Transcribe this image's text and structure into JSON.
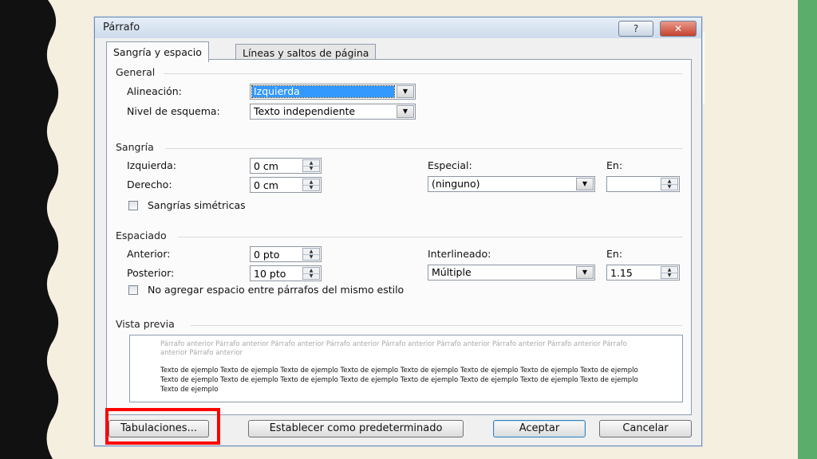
{
  "dialog": {
    "title": "Párrafo",
    "help_icon": "?",
    "close_icon": "✕"
  },
  "tabs": [
    {
      "label": "Sangría y espacio",
      "active": true
    },
    {
      "label": "Líneas y saltos de página",
      "active": false
    }
  ],
  "general": {
    "section_title": "General",
    "alignment_label": "Alineación:",
    "alignment_value": "Izquierda",
    "outline_label": "Nivel de esquema:",
    "outline_value": "Texto independiente"
  },
  "indent": {
    "section_title": "Sangría",
    "left_label": "Izquierda:",
    "left_value": "0 cm",
    "right_label": "Derecho:",
    "right_value": "0 cm",
    "special_label": "Especial:",
    "special_value": "(ninguno)",
    "by_label": "En:",
    "by_value": "",
    "mirror_label": "Sangrías simétricas"
  },
  "spacing": {
    "section_title": "Espaciado",
    "before_label": "Anterior:",
    "before_value": "0 pto",
    "after_label": "Posterior:",
    "after_value": "10 pto",
    "line_label": "Interlineado:",
    "line_value": "Múltiple",
    "at_label": "En:",
    "at_value": "1.15",
    "no_space_label": "No agregar espacio entre párrafos del mismo estilo"
  },
  "preview": {
    "section_title": "Vista previa",
    "previous_text": "Párrafo anterior Párrafo anterior Párrafo anterior Párrafo anterior Párrafo anterior Párrafo anterior Párrafo anterior Párrafo anterior Párrafo anterior Párrafo anterior",
    "sample_text": "Texto de ejemplo Texto de ejemplo Texto de ejemplo Texto de ejemplo Texto de ejemplo Texto de ejemplo Texto de ejemplo Texto de ejemplo Texto de ejemplo Texto de ejemplo Texto de ejemplo Texto de ejemplo Texto de ejemplo Texto de ejemplo Texto de ejemplo Texto de ejemplo Texto de ejemplo"
  },
  "buttons": {
    "tabs_label": "Tabulaciones...",
    "default_label": "Establecer como predeterminado",
    "ok_label": "Aceptar",
    "cancel_label": "Cancelar"
  },
  "colors": {
    "highlight": "#ff0000",
    "right_band": "#5aad6a",
    "left_band": "#111111",
    "background": "#f5efe0",
    "selection": "#3399ff"
  }
}
